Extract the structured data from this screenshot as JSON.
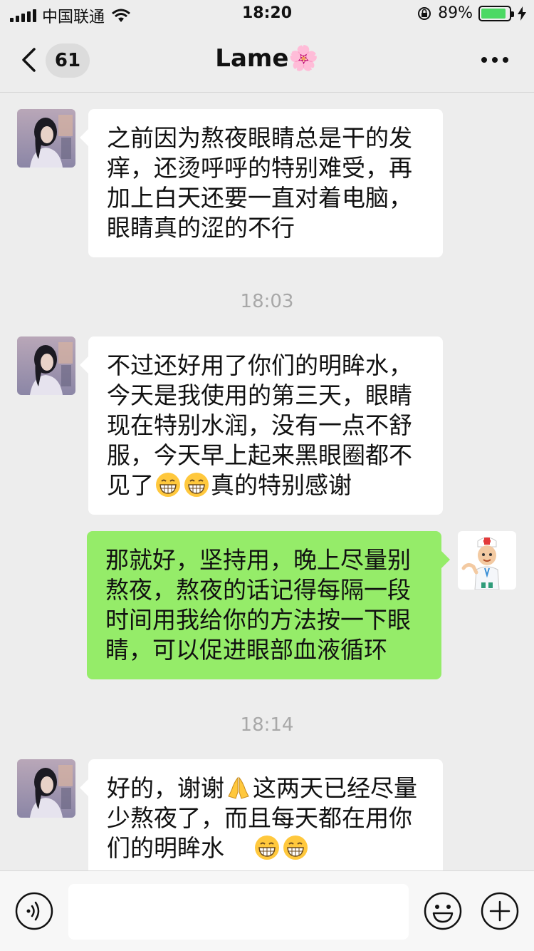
{
  "status_bar": {
    "carrier": "中国联通",
    "time": "18:20",
    "battery": "89%",
    "battery_level": 0.89
  },
  "nav": {
    "unread_count": "61",
    "title": "Lame🌸"
  },
  "messages": [
    {
      "type": "received",
      "text": "之前因为熬夜眼睛总是干的发痒，还烫呼呼的特别难受，再加上白天还要一直对着电脑，眼睛真的涩的不行"
    },
    {
      "type": "time",
      "text": "18:03"
    },
    {
      "type": "received",
      "text_a": "不过还好用了你们的明眸水，今天是我使用的第三天，眼睛现在特别水润，没有一点不舒服，今天早上起来黑眼圈都不见了",
      "emojis": [
        "grinning-face",
        "grinning-face"
      ],
      "text_b": "真的特别感谢"
    },
    {
      "type": "sent",
      "text": "那就好，坚持用，晚上尽量别熬夜，熬夜的话记得每隔一段时间用我给你的方法按一下眼睛，可以促进眼部血液循环"
    },
    {
      "type": "time",
      "text": "18:14"
    },
    {
      "type": "received",
      "text_a": "好的，谢谢",
      "emoji_mid": "folded-hands",
      "text_b": "这两天已经尽量少熬夜了，而且每天都在用你们的明眸水",
      "emojis": [
        "grinning-face",
        "grinning-face"
      ]
    }
  ],
  "colors": {
    "background": "#ededed",
    "received_bubble": "#ffffff",
    "sent_bubble": "#95ec69",
    "battery_fill": "#4cd964"
  }
}
